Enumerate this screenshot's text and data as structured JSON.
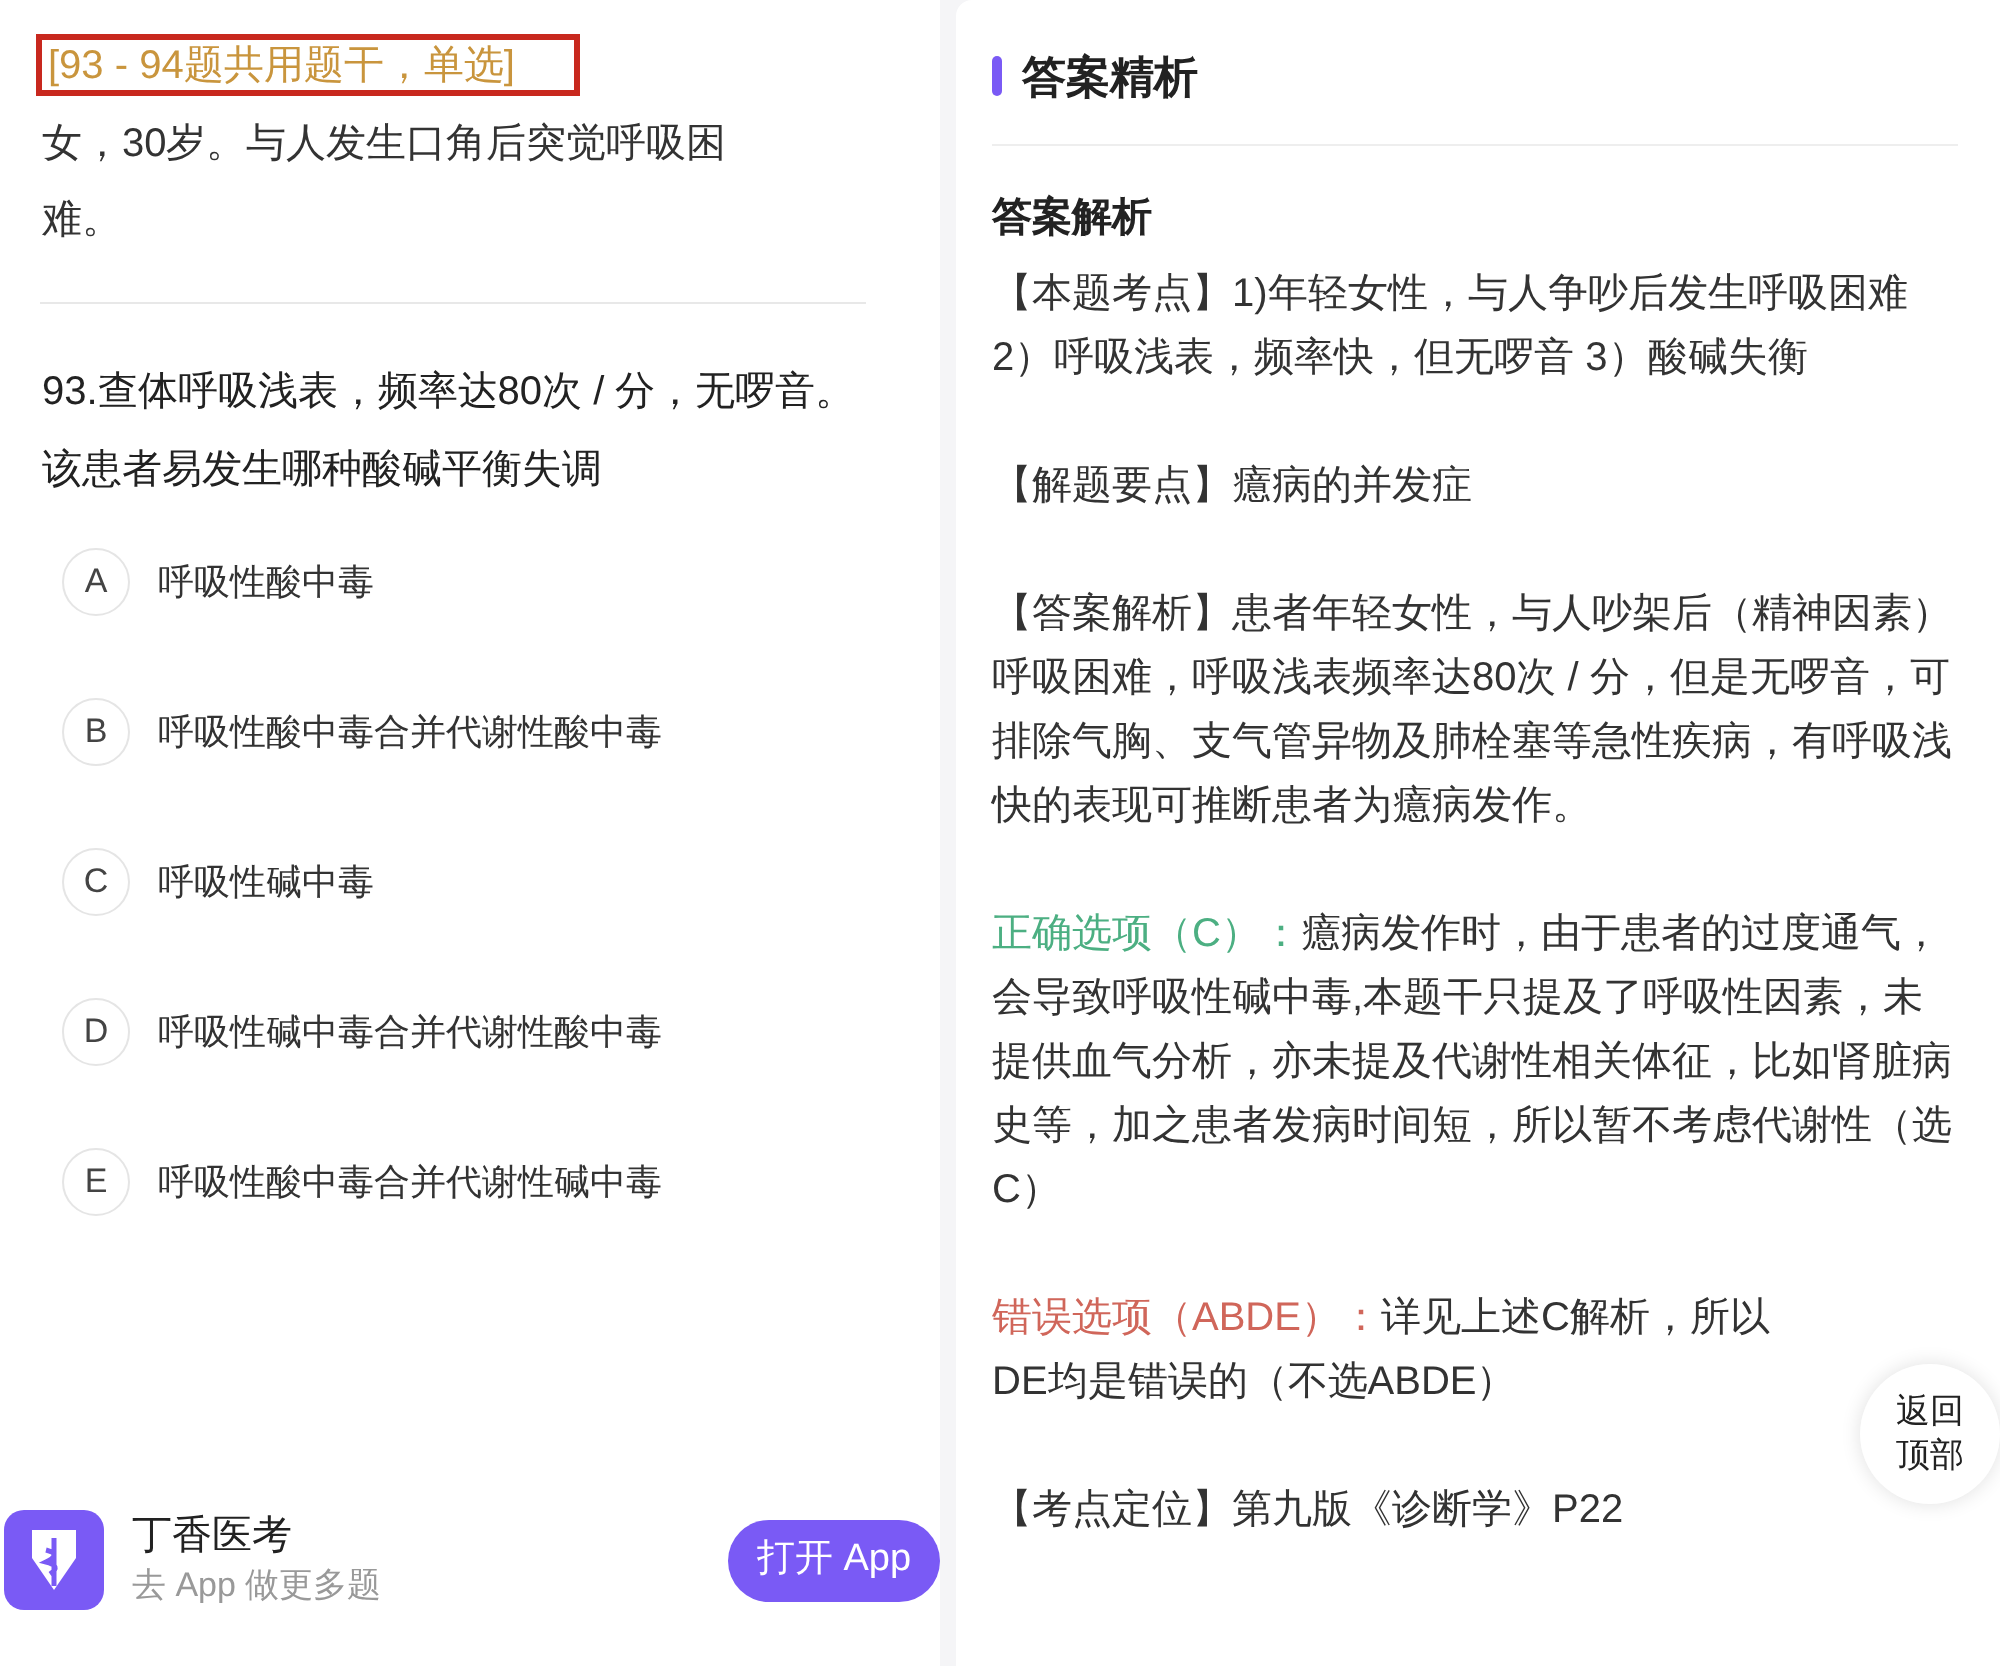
{
  "question": {
    "tag": "[93 - 94题共用题干，单选]",
    "stem": "女，30岁。与人发生口角后突觉呼吸困难。",
    "text": "93.查体呼吸浅表，频率达80次 / 分，无啰音。该患者易发生哪种酸碱平衡失调",
    "options": [
      {
        "letter": "A",
        "text": "呼吸性酸中毒"
      },
      {
        "letter": "B",
        "text": "呼吸性酸中毒合并代谢性酸中毒"
      },
      {
        "letter": "C",
        "text": "呼吸性碱中毒"
      },
      {
        "letter": "D",
        "text": "呼吸性碱中毒合并代谢性酸中毒"
      },
      {
        "letter": "E",
        "text": "呼吸性酸中毒合并代谢性碱中毒"
      }
    ]
  },
  "app_banner": {
    "name": "丁香医考",
    "subtitle": "去 App 做更多题",
    "button": "打开 App"
  },
  "analysis": {
    "title": "答案精析",
    "subtitle": "答案解析",
    "paragraphs": [
      {
        "kind": "text",
        "text": "【本题考点】1)年轻女性，与人争吵后发生呼吸困难 2）呼吸浅表，频率快，但无啰音 3）酸碱失衡"
      },
      {
        "kind": "text",
        "text": "【解题要点】癔病的并发症"
      },
      {
        "kind": "text",
        "text": "【答案解析】患者年轻女性，与人吵架后（精神因素）呼吸困难，呼吸浅表频率达80次 / 分，但是无啰音，可排除气胸、支气管异物及肺栓塞等急性疾病，有呼吸浅快的表现可推断患者为癔病发作。"
      },
      {
        "kind": "correct",
        "label": "正确选项（C）：",
        "text": "癔病发作时，由于患者的过度通气，会导致呼吸性碱中毒,本题干只提及了呼吸性因素，未提供血气分析，亦未提及代谢性相关体征，比如肾脏病史等，加之患者发病时间短，所以暂不考虑代谢性（选C）"
      },
      {
        "kind": "wrong",
        "label": "错误选项（ABDE）：",
        "text": "详见上述C解析，所以",
        "text_2": "DE均是错误的（不选ABDE）"
      },
      {
        "kind": "text",
        "text": "【考点定位】第九版《诊断学》P22"
      }
    ]
  },
  "back_to_top": "返回顶部"
}
